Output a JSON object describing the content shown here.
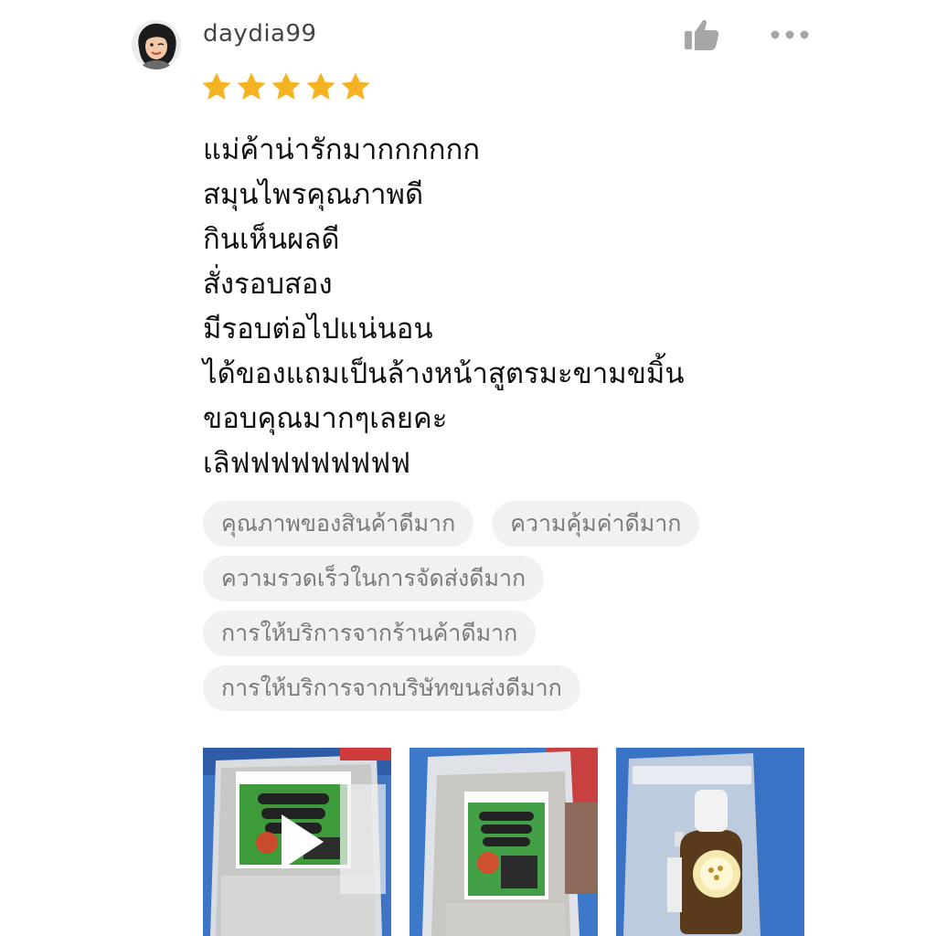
{
  "review": {
    "username": "daydia99",
    "rating": 5,
    "rating_max": 5,
    "lines": [
      "แม่ค้าน่ารักมากกกกกก",
      "สมุนไพรคุณภาพดี",
      "กินเห็นผลดี",
      "สั่งรอบสอง",
      "มีรอบต่อไปแน่นอน",
      "ได้ของแถมเป็นล้างหน้าสูตรมะขามขมิ้น",
      "ขอบคุณมากๆเลยคะ",
      "เลิฟฟฟฟฟฟฟฟฟ"
    ],
    "tags": [
      "คุณภาพของสินค้าดีมาก",
      "ความคุ้มค่าดีมาก",
      "ความรวดเร็วในการจัดส่งดีมาก",
      "การให้บริการจากร้านค้าดีมาก",
      "การให้บริการจากบริษัทขนส่งดีมาก"
    ],
    "media": [
      {
        "kind": "video",
        "icon": "play-icon"
      },
      {
        "kind": "image"
      },
      {
        "kind": "image"
      }
    ]
  },
  "icons": {
    "like": "thumbs-up-icon",
    "more": "more-options-icon",
    "star": "star-icon"
  },
  "colors": {
    "star": "#f5b324",
    "tag_bg": "#f1f1f1",
    "tag_text": "#7b7b7b",
    "icon_gray": "#a7a7a7"
  }
}
